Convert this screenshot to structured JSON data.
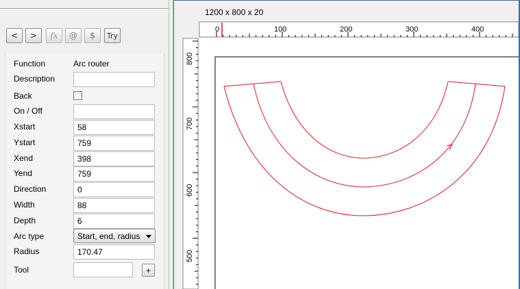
{
  "toolbar": {
    "back_label": "<",
    "forward_label": ">",
    "fx_label": "fx",
    "at_label": "@",
    "dollar_label": "$",
    "try_label": "Try"
  },
  "form": {
    "function_label": "Function",
    "function_value": "Arc router",
    "description_label": "Description",
    "description_value": "",
    "back_label": "Back",
    "back_checked": false,
    "onoff_label": "On / Off",
    "onoff_value": "",
    "xstart_label": "Xstart",
    "xstart_value": "58",
    "ystart_label": "Ystart",
    "ystart_value": "759",
    "xend_label": "Xend",
    "xend_value": "398",
    "yend_label": "Yend",
    "yend_value": "759",
    "direction_label": "Direction",
    "direction_value": "0",
    "width_label": "Width",
    "width_value": "88",
    "depth_label": "Depth",
    "depth_value": "6",
    "arctype_label": "Arc type",
    "arctype_value": "Start, end, radius",
    "radius_label": "Radius",
    "radius_value": "170.47",
    "tool_label": "Tool",
    "tool_value": "",
    "tool_add_label": "+"
  },
  "canvas": {
    "doc_size": "1200 x 800 x 20",
    "ruler_h_labels": [
      "0",
      "100",
      "200",
      "300",
      "400"
    ],
    "ruler_v_labels": [
      "800",
      "700",
      "600",
      "500"
    ],
    "stroke_color": "#e0141b"
  }
}
